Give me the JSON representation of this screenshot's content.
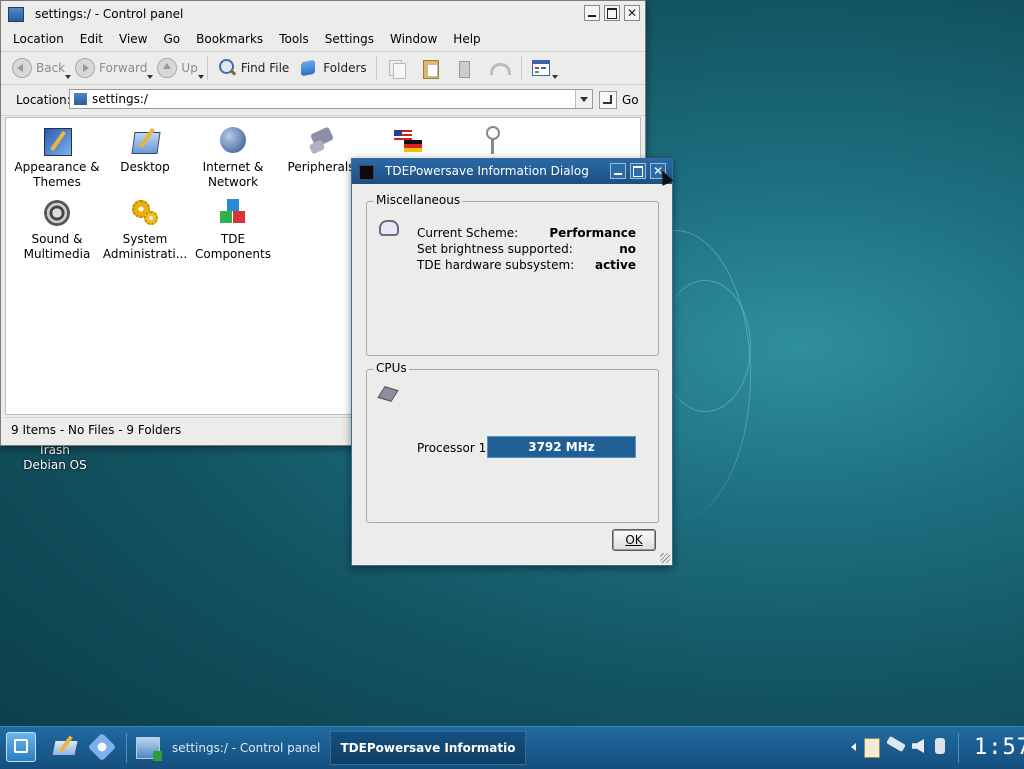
{
  "desktop": {
    "trash_label": "Trash",
    "debian_label": "Debian OS"
  },
  "control_panel": {
    "title": "settings:/ - Control panel",
    "menu": [
      "Location",
      "Edit",
      "View",
      "Go",
      "Bookmarks",
      "Tools",
      "Settings",
      "Window",
      "Help"
    ],
    "toolbar": {
      "back": "Back",
      "forward": "Forward",
      "up": "Up",
      "find_file": "Find File",
      "folders": "Folders"
    },
    "location_label": "Location:",
    "location_value": "settings:/",
    "go_label": "Go",
    "items": [
      {
        "line1": "Appearance &",
        "line2": "Themes"
      },
      {
        "line1": "Desktop",
        "line2": ""
      },
      {
        "line1": "Internet &",
        "line2": "Network"
      },
      {
        "line1": "Peripherals",
        "line2": ""
      },
      {
        "line1": "Sound &",
        "line2": "Multimedia"
      },
      {
        "line1": "System",
        "line2": "Administrati..."
      },
      {
        "line1": "TDE",
        "line2": "Components"
      }
    ],
    "status": "9 Items - No Files - 9 Folders"
  },
  "dialog": {
    "title": "TDEPowersave Information Dialog",
    "misc_group": "Miscellaneous",
    "rows": [
      {
        "label": "Current Scheme:",
        "value": "Performance"
      },
      {
        "label": "Set brightness supported:",
        "value": "no"
      },
      {
        "label": "TDE hardware subsystem:",
        "value": "active"
      }
    ],
    "cpus_group": "CPUs",
    "processor_label": "Processor 1",
    "processor_value": "3792 MHz",
    "ok": "OK"
  },
  "taskbar": {
    "task1": "settings:/ - Control panel",
    "task2": "TDEPowersave Informatio",
    "clock": "1:57"
  },
  "colors": {
    "accent": "#1f5f94",
    "taskbar": "#1b5d8f",
    "desktop": "#1a5e6c"
  }
}
